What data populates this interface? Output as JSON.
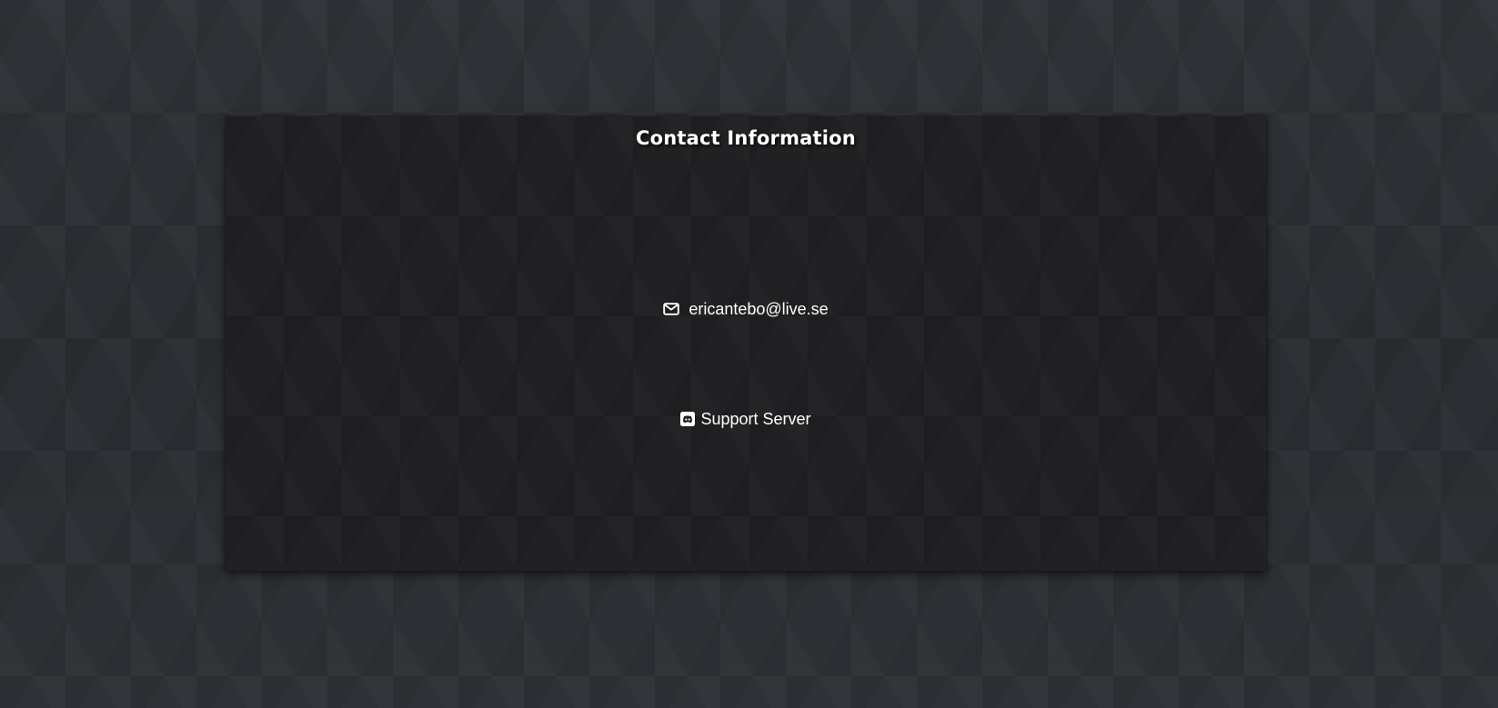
{
  "page": {
    "background_color": "#2c2f33",
    "panel_color": "#212124",
    "text_color": "#ffffff"
  },
  "contact": {
    "title": "Contact Information",
    "email": {
      "icon": "envelope-icon",
      "text": "ericantebo@live.se"
    },
    "discord": {
      "icon": "discord-icon",
      "text": "Support Server"
    }
  }
}
